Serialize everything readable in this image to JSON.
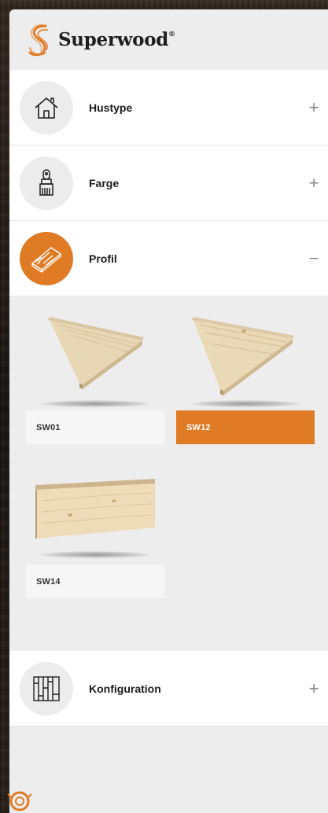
{
  "brand": {
    "name": "Superwood",
    "reg_mark": "®"
  },
  "sections": [
    {
      "label": "Hustype",
      "icon": "house-icon",
      "expanded": false,
      "toggle": "+"
    },
    {
      "label": "Farge",
      "icon": "paint-brush-icon",
      "expanded": false,
      "toggle": "+"
    },
    {
      "label": "Profil",
      "icon": "wood-board-icon",
      "expanded": true,
      "toggle": "−"
    },
    {
      "label": "Konfiguration",
      "icon": "panel-config-icon",
      "expanded": false,
      "toggle": "+"
    }
  ],
  "profiles": [
    {
      "code": "SW01",
      "selected": false
    },
    {
      "code": "SW12",
      "selected": true
    },
    {
      "code": "SW14",
      "selected": false
    }
  ],
  "colors": {
    "accent": "#e07b25",
    "panel": "#ededed",
    "row": "#ffffff"
  }
}
